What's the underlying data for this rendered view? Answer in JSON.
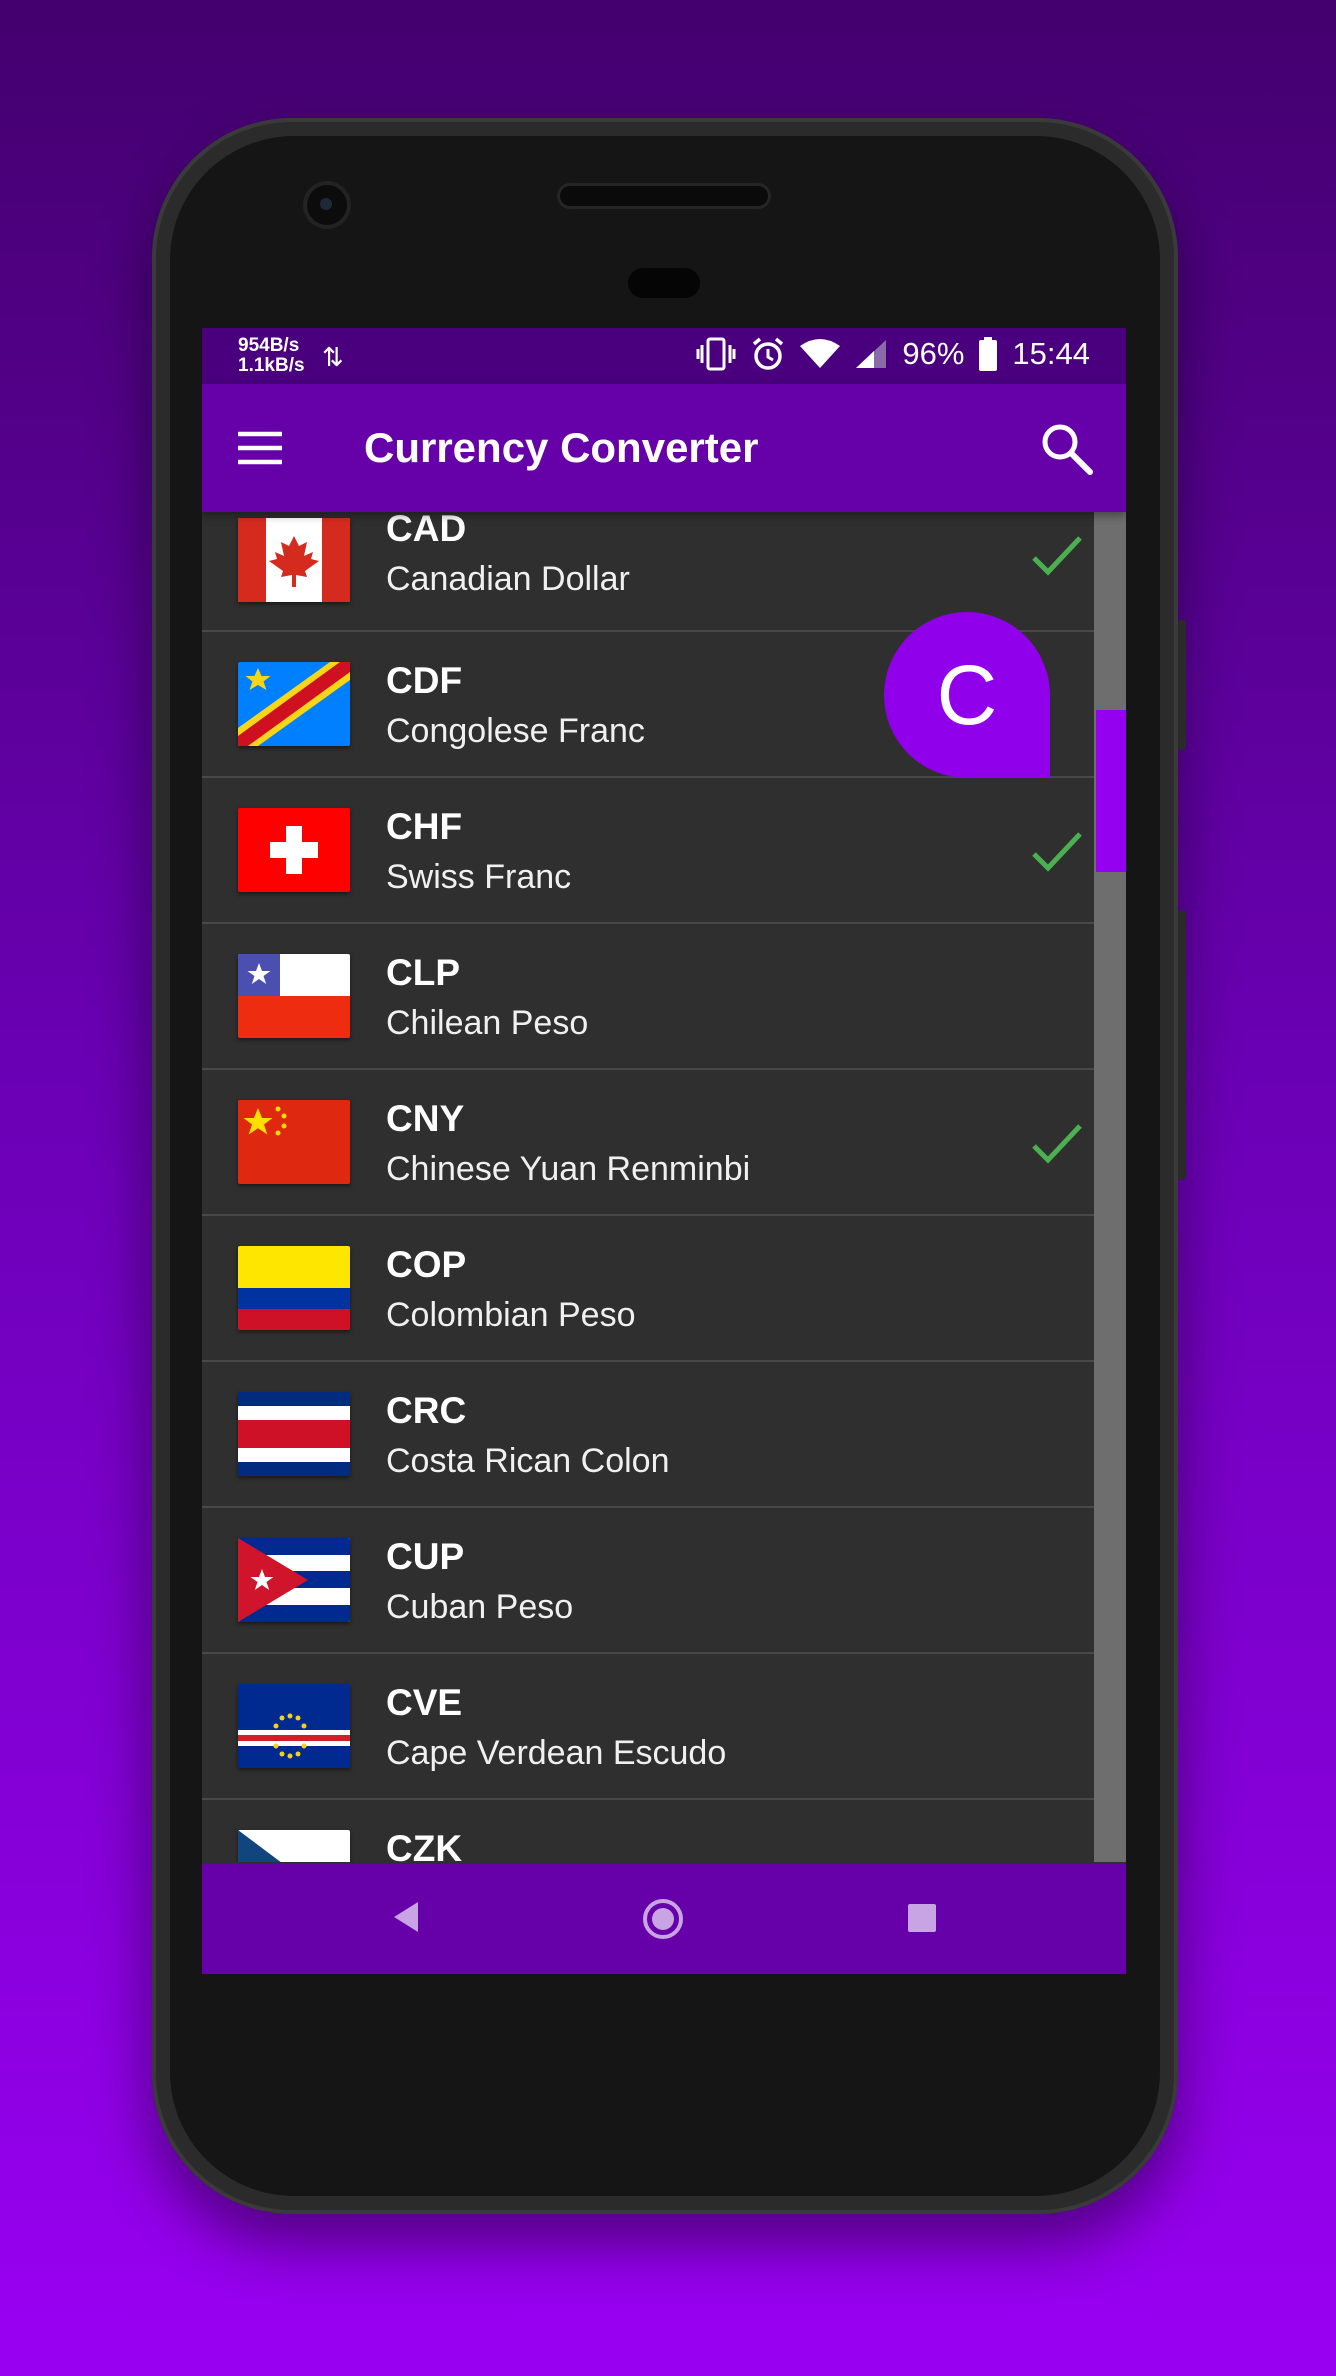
{
  "statusbar": {
    "net_up": "954B/s",
    "net_down": "1.1kB/s",
    "battery": "96%",
    "time": "15:44"
  },
  "appbar": {
    "title": "Currency Converter"
  },
  "colors": {
    "primary": "#6600a8",
    "accent": "#9000ea",
    "check": "#4caf50"
  },
  "section_bubble": "C",
  "currencies": [
    {
      "code": "CAD",
      "name": "Canadian Dollar",
      "selected": true,
      "flag": "canada-flag-icon"
    },
    {
      "code": "CDF",
      "name": "Congolese Franc",
      "selected": false,
      "flag": "congo-flag-icon"
    },
    {
      "code": "CHF",
      "name": "Swiss Franc",
      "selected": true,
      "flag": "switzerland-flag-icon"
    },
    {
      "code": "CLP",
      "name": "Chilean Peso",
      "selected": false,
      "flag": "chile-flag-icon"
    },
    {
      "code": "CNY",
      "name": "Chinese Yuan Renminbi",
      "selected": true,
      "flag": "china-flag-icon"
    },
    {
      "code": "COP",
      "name": "Colombian Peso",
      "selected": false,
      "flag": "colombia-flag-icon"
    },
    {
      "code": "CRC",
      "name": "Costa Rican Colon",
      "selected": false,
      "flag": "costa-rica-flag-icon"
    },
    {
      "code": "CUP",
      "name": "Cuban Peso",
      "selected": false,
      "flag": "cuba-flag-icon"
    },
    {
      "code": "CVE",
      "name": "Cape Verdean Escudo",
      "selected": false,
      "flag": "cape-verde-flag-icon"
    },
    {
      "code": "CZK",
      "name": "",
      "selected": false,
      "flag": "czech-flag-icon"
    }
  ]
}
